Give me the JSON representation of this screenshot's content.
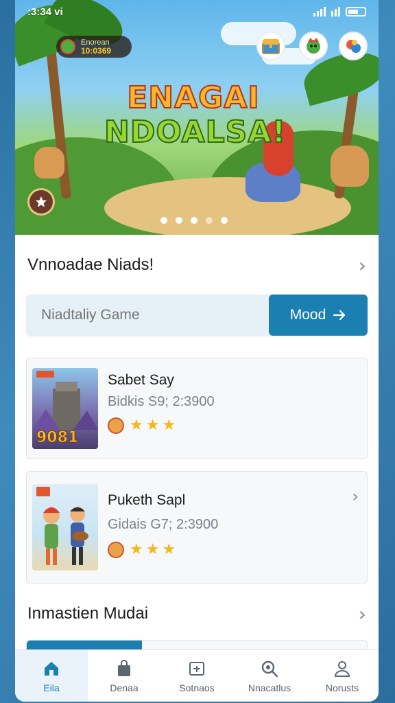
{
  "status": {
    "time": ":3:34 vi"
  },
  "hero": {
    "coin_label": "Enorean",
    "coin_value": "10:0369",
    "title_line1": "ENAGAI",
    "title_line2": "NDOALSA!",
    "carousel_pages": 5,
    "carousel_active": 0
  },
  "section1": {
    "title": "Vnnoadae Niads!"
  },
  "search": {
    "placeholder": "Niadtaliy Game",
    "button_label": "Mood"
  },
  "games": [
    {
      "title": "Sabet Say",
      "subtitle": "Bidkis S9; 2:3900",
      "rating": 3,
      "thumb_text": "9081"
    },
    {
      "title": "Puketh Sapl",
      "subtitle": "Gidais G7; 2:3900",
      "rating": 3
    }
  ],
  "section2": {
    "title": "Inmastien Mudai"
  },
  "nav": {
    "items": [
      {
        "label": "Eila",
        "icon": "home-icon"
      },
      {
        "label": "Denaa",
        "icon": "bag-icon"
      },
      {
        "label": "Sotnaos",
        "icon": "news-icon"
      },
      {
        "label": "Nnacatlus",
        "icon": "search-icon"
      },
      {
        "label": "Norusts",
        "icon": "profile-icon"
      }
    ],
    "active_index": 0
  },
  "colors": {
    "accent": "#1b7fb2",
    "star": "#f4b81a"
  }
}
